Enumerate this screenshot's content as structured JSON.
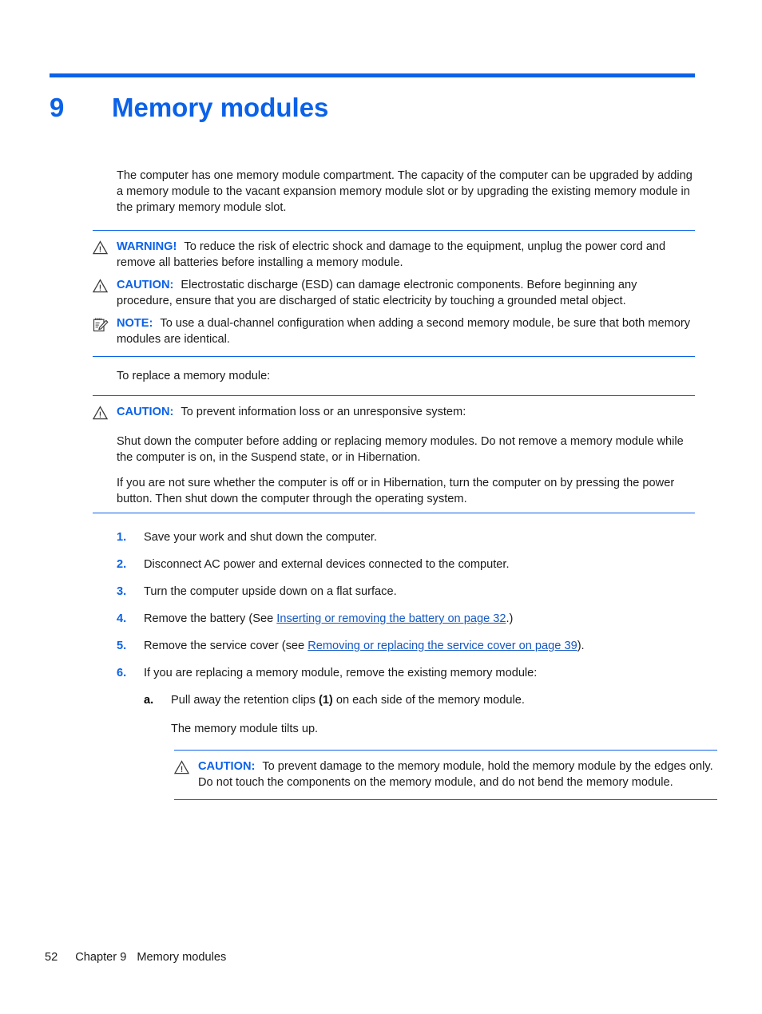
{
  "chapter": {
    "number": "9",
    "title": "Memory modules",
    "accent_color": "#0b62e8"
  },
  "intro": {
    "paragraph": "The computer has one memory module compartment. The capacity of the computer can be upgraded by adding a memory module to the vacant expansion memory module slot or by upgrading the existing memory module in the primary memory module slot."
  },
  "admonitions": {
    "warning": {
      "label": "WARNING!",
      "icon": "warning-triangle-icon",
      "text": "To reduce the risk of electric shock and damage to the equipment, unplug the power cord and remove all batteries before installing a memory module."
    },
    "caution_esd": {
      "label": "CAUTION:",
      "icon": "warning-triangle-icon",
      "text": "Electrostatic discharge (ESD) can damage electronic components. Before beginning any procedure, ensure that you are discharged of static electricity by touching a grounded metal object."
    },
    "note_dual_channel": {
      "label": "NOTE:",
      "icon": "note-pencil-icon",
      "text": "To use a dual-channel configuration when adding a second memory module, be sure that both memory modules are identical."
    },
    "caution_data_loss": {
      "label": "CAUTION:",
      "icon": "warning-triangle-icon",
      "text": "To prevent information loss or an unresponsive system:",
      "body_paragraph_1": "Shut down the computer before adding or replacing memory modules. Do not remove a memory module while the computer is on, in the Suspend state, or in Hibernation.",
      "body_paragraph_2": "If you are not sure whether the computer is off or in Hibernation, turn the computer on by pressing the power button. Then shut down the computer through the operating system."
    },
    "caution_handling": {
      "label": "CAUTION:",
      "icon": "warning-triangle-icon",
      "text": "To prevent damage to the memory module, hold the memory module by the edges only. Do not touch the components on the memory module, and do not bend the memory module."
    }
  },
  "lead_in": {
    "text": "To replace a memory module:"
  },
  "steps": [
    {
      "num": "1.",
      "text": "Save your work and shut down the computer."
    },
    {
      "num": "2.",
      "text": "Disconnect AC power and external devices connected to the computer."
    },
    {
      "num": "3.",
      "text": "Turn the computer upside down on a flat surface."
    },
    {
      "num": "4.",
      "text_before": "Remove the battery (See ",
      "link": "Inserting or removing the battery on page 32",
      "text_after": ".)"
    },
    {
      "num": "5.",
      "text_before": "Remove the service cover (see ",
      "link": "Removing or replacing the service cover on page 39",
      "text_after": ")."
    },
    {
      "num": "6.",
      "text": "If you are replacing a memory module, remove the existing memory module:"
    }
  ],
  "substeps": [
    {
      "num": "a.",
      "text_before": "Pull away the retention clips ",
      "bold": "(1)",
      "text_after": " on each side of the memory module.",
      "follow_up": "The memory module tilts up."
    }
  ],
  "footer": {
    "page_number": "52",
    "chapter_label": "Chapter 9",
    "chapter_title": "Memory modules"
  }
}
